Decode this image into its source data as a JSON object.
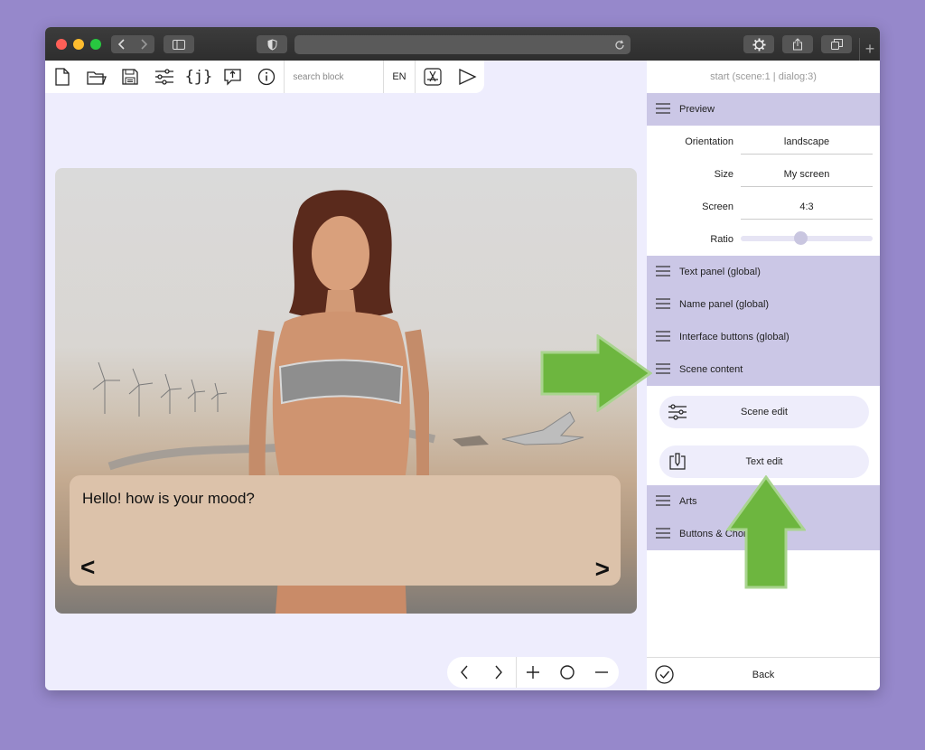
{
  "toolbar": {
    "search_placeholder": "search block",
    "language": "EN"
  },
  "panel": {
    "title": "start (scene:1 | dialog:3)",
    "preview": {
      "label": "Preview",
      "rows": [
        {
          "label": "Orientation",
          "value": "landscape"
        },
        {
          "label": "Size",
          "value": "My screen"
        },
        {
          "label": "Screen",
          "value": "4:3"
        }
      ],
      "ratio_label": "Ratio",
      "ratio_level": 0.45
    },
    "sections": {
      "text_panel": "Text panel (global)",
      "name_panel": "Name panel (global)",
      "interface_buttons": "Interface buttons (global)",
      "scene_content": "Scene content",
      "arts": "Arts",
      "buttons_choices": "Buttons & Choi"
    },
    "scene_edit": "Scene edit",
    "text_edit": "Text edit",
    "back": "Back"
  },
  "stage": {
    "dialog_text": "Hello! how is your mood?",
    "prev": "<",
    "next": ">"
  },
  "colors": {
    "accent_arrow": "#6db63f",
    "section_bg": "#cbc7e6",
    "dialog_bg": "#dcc2aa"
  }
}
